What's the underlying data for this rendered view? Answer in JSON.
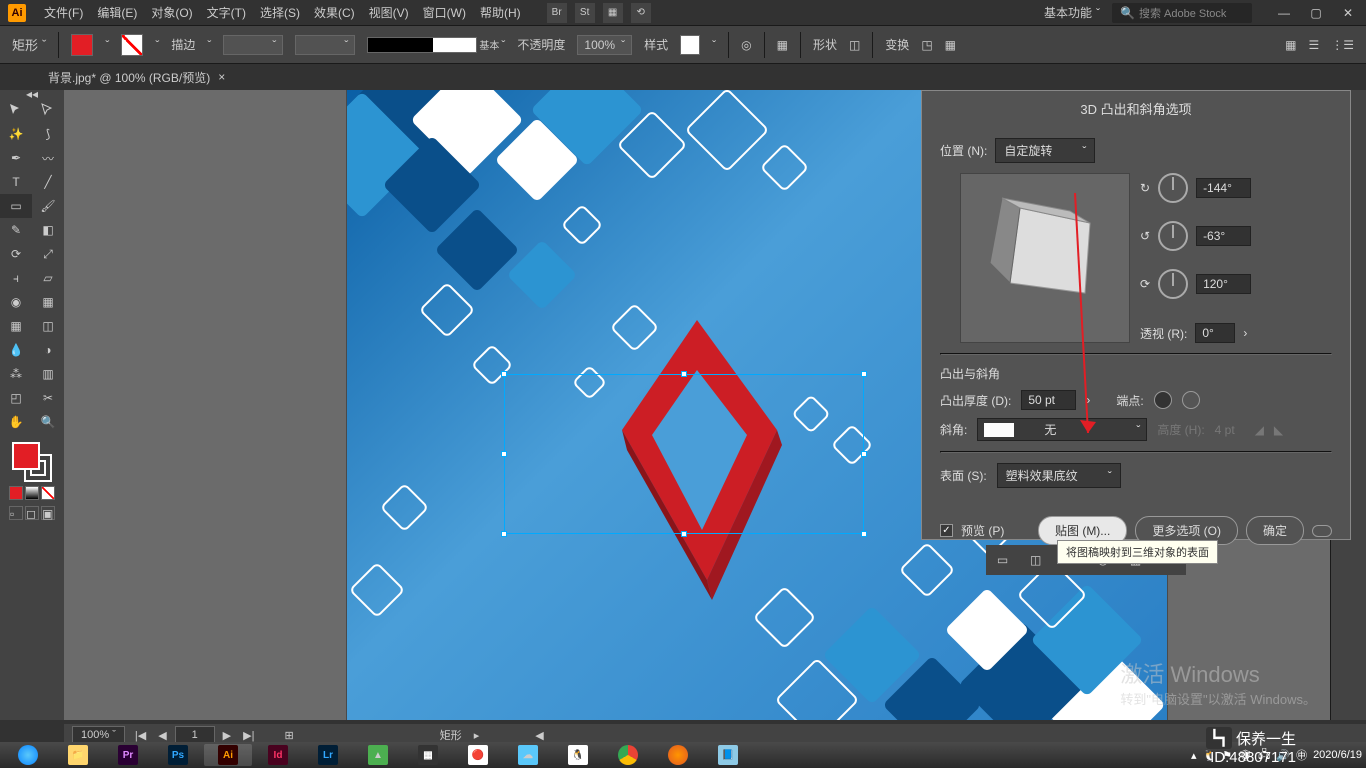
{
  "app": {
    "logo": "Ai"
  },
  "menu": [
    "文件(F)",
    "编辑(E)",
    "对象(O)",
    "文字(T)",
    "选择(S)",
    "效果(C)",
    "视图(V)",
    "窗口(W)",
    "帮助(H)"
  ],
  "title_icons": [
    "Br",
    "St"
  ],
  "workspace": "基本功能",
  "search_placeholder": "搜索 Adobe Stock",
  "control": {
    "tool": "矩形",
    "stroke_label": "描边",
    "stroke_weight": "",
    "stroke_style": "基本",
    "opacity_label": "不透明度",
    "opacity_value": "100%",
    "style_label": "样式",
    "shape_label": "形状",
    "transform_label": "变换"
  },
  "doc_tab": "背景.jpg* @ 100% (RGB/预览)",
  "status": {
    "zoom": "100%",
    "page": "1",
    "tool": "矩形"
  },
  "dialog": {
    "title": "3D 凸出和斜角选项",
    "position_label": "位置 (N):",
    "position_value": "自定旋转",
    "angle_x": "-144°",
    "angle_y": "-63°",
    "angle_z": "120°",
    "perspective_label": "透视 (R):",
    "perspective_value": "0°",
    "section1": "凸出与斜角",
    "depth_label": "凸出厚度 (D):",
    "depth_value": "50 pt",
    "cap_label": "端点:",
    "bevel_label": "斜角:",
    "bevel_value": "无",
    "height_label": "高度 (H):",
    "height_value": "4 pt",
    "surface_label": "表面 (S):",
    "surface_value": "塑料效果底纹",
    "preview": "预览 (P)",
    "map_art": "贴图 (M)...",
    "more_options": "更多选项 (O)",
    "ok": "确定"
  },
  "tooltip": "将图稿映射到三维对象的表面",
  "watermark": {
    "title": "激活 Windows",
    "sub": "转到\"电脑设置\"以激活 Windows。"
  },
  "id_stamp": {
    "brand": "保养一生",
    "id": "ID:48807171"
  },
  "taskbar_date": "2020/6/19"
}
